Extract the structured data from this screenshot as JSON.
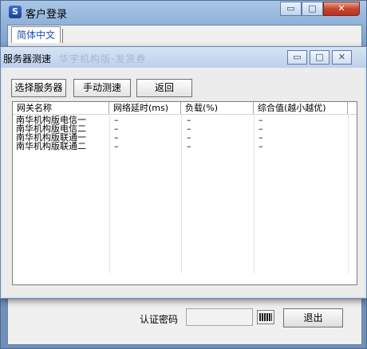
{
  "main_window": {
    "title": "客户登录",
    "language_tab": "简体中文",
    "auth_label": "认证密码",
    "auth_value": "",
    "exit_label": "退出",
    "min_glyph": "▭",
    "max_glyph": "□",
    "close_glyph": "✕"
  },
  "dialog": {
    "title": "服务器测速",
    "ghost_text": "华宇机构版-发货券",
    "min_glyph": "▭",
    "max_glyph": "□",
    "close_glyph": "✕",
    "buttons": {
      "select_server": "选择服务器",
      "manual_test": "手动测速",
      "back": "返回"
    },
    "columns": [
      "网关名称",
      "网络延时(ms)",
      "负载(%)",
      "综合值(越小越优)"
    ],
    "rows": [
      {
        "name": "南华机构版电信一",
        "latency": "–",
        "load": "–",
        "score": "–"
      },
      {
        "name": "南华机构版电信二",
        "latency": "–",
        "load": "–",
        "score": "–"
      },
      {
        "name": "南华机构版联通一",
        "latency": "–",
        "load": "–",
        "score": "–"
      },
      {
        "name": "南华机构版联通二",
        "latency": "–",
        "load": "–",
        "score": "–"
      }
    ]
  },
  "icons": {
    "app_icon": "app-logo-icon",
    "keyboard": "keyboard-icon"
  },
  "colors": {
    "tab_text": "#1a4fb5",
    "close_button": "#c8452f",
    "title_bar": "#a9c6e6"
  }
}
